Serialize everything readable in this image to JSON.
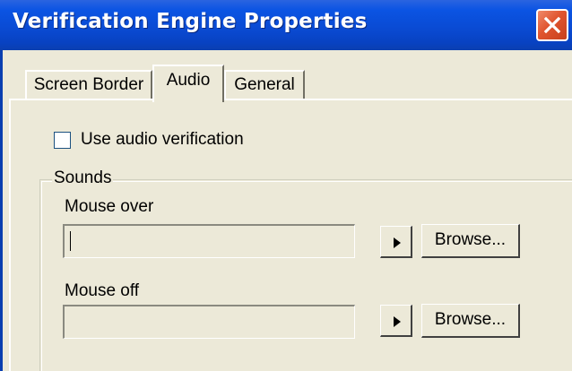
{
  "window": {
    "title": "Verification Engine Properties",
    "close_icon": "close-icon",
    "title_color": "#0a4bd4",
    "close_color": "#e0552f"
  },
  "tabs": [
    {
      "label": "Screen Border",
      "selected": false
    },
    {
      "label": "Audio",
      "selected": true
    },
    {
      "label": "General",
      "selected": false
    }
  ],
  "audio": {
    "use_audio_label": "Use audio verification",
    "use_audio_checked": false,
    "sounds_group_label": "Sounds",
    "mouse_over": {
      "label": "Mouse over",
      "value": "",
      "play_icon": "play-icon",
      "browse_label": "Browse..."
    },
    "mouse_off": {
      "label": "Mouse off",
      "value": "",
      "play_icon": "play-icon",
      "browse_label": "Browse..."
    }
  }
}
